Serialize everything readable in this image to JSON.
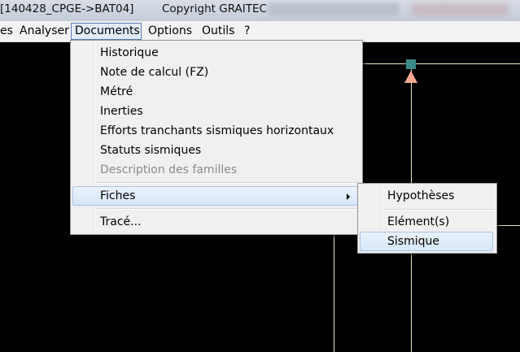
{
  "window": {
    "title": "[140428_CPGE->BAT04]",
    "copyright": "Copyright GRAITEC"
  },
  "menubar": {
    "items": [
      "es",
      "Analyser",
      "Documents",
      "Options",
      "Outils",
      "?"
    ],
    "active": "Documents"
  },
  "documents_menu": {
    "items": [
      {
        "label": "Historique",
        "enabled": true
      },
      {
        "label": "Note de calcul  (FZ)",
        "enabled": true
      },
      {
        "label": "Métré",
        "enabled": true
      },
      {
        "label": "Inerties",
        "enabled": true
      },
      {
        "label": "Efforts tranchants sismiques horizontaux",
        "enabled": true
      },
      {
        "label": "Statuts sismiques",
        "enabled": true
      },
      {
        "label": "Description des familles",
        "enabled": false
      },
      {
        "label": "Fiches",
        "enabled": true,
        "submenu": true,
        "highlighted": true
      },
      {
        "label": "Tracé...",
        "enabled": true
      }
    ]
  },
  "fiches_submenu": {
    "items": [
      {
        "label": "Hypothèses"
      },
      {
        "label": "Elément(s)"
      },
      {
        "label": "Sismique",
        "highlighted": true
      }
    ]
  }
}
